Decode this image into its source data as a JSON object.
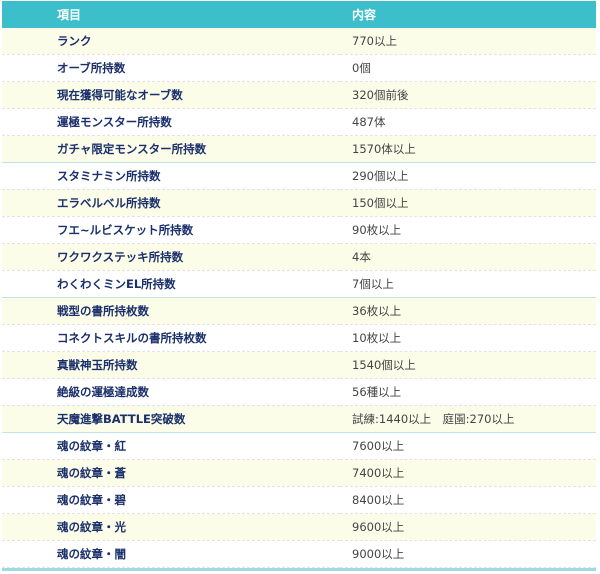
{
  "header": {
    "col1": "項目",
    "col2": "内容"
  },
  "rows": [
    {
      "item": "ランク",
      "value": "770以上"
    },
    {
      "item": "オーブ所持数",
      "value": "0個"
    },
    {
      "item": "現在獲得可能なオーブ数",
      "value": "320個前後"
    },
    {
      "item": "運極モンスター所持数",
      "value": "487体"
    },
    {
      "item": "ガチャ限定モンスター所持数",
      "value": "1570体以上"
    },
    {
      "item": "スタミナミン所持数",
      "value": "290個以上"
    },
    {
      "item": "エラベルベル所持数",
      "value": "150個以上"
    },
    {
      "item": "フエ~ルビスケット所持数",
      "value": "90枚以上"
    },
    {
      "item": "ワクワクステッキ所持数",
      "value": "4本"
    },
    {
      "item": "わくわくミンEL所持数",
      "value": "7個以上"
    },
    {
      "item": "戦型の書所持枚数",
      "value": "36枚以上"
    },
    {
      "item": "コネクトスキルの書所持枚数",
      "value": "10枚以上"
    },
    {
      "item": "真獣神玉所持数",
      "value": "1540個以上"
    },
    {
      "item": "絶級の運極達成数",
      "value": "56種以上"
    },
    {
      "item": "天魔進撃BATTLE突破数",
      "value": "試練:1440以上　庭園:270以上"
    },
    {
      "item": "魂の紋章・紅",
      "value": "7600以上"
    },
    {
      "item": "魂の紋章・蒼",
      "value": "7400以上"
    },
    {
      "item": "魂の紋章・碧",
      "value": "8400以上"
    },
    {
      "item": "魂の紋章・光",
      "value": "9600以上"
    },
    {
      "item": "魂の紋章・闇",
      "value": "9000以上"
    }
  ],
  "colors": {
    "header_bg": "#3dbfcb",
    "odd_row_bg": "#fbfde9",
    "item_text": "#1a2f6b"
  }
}
